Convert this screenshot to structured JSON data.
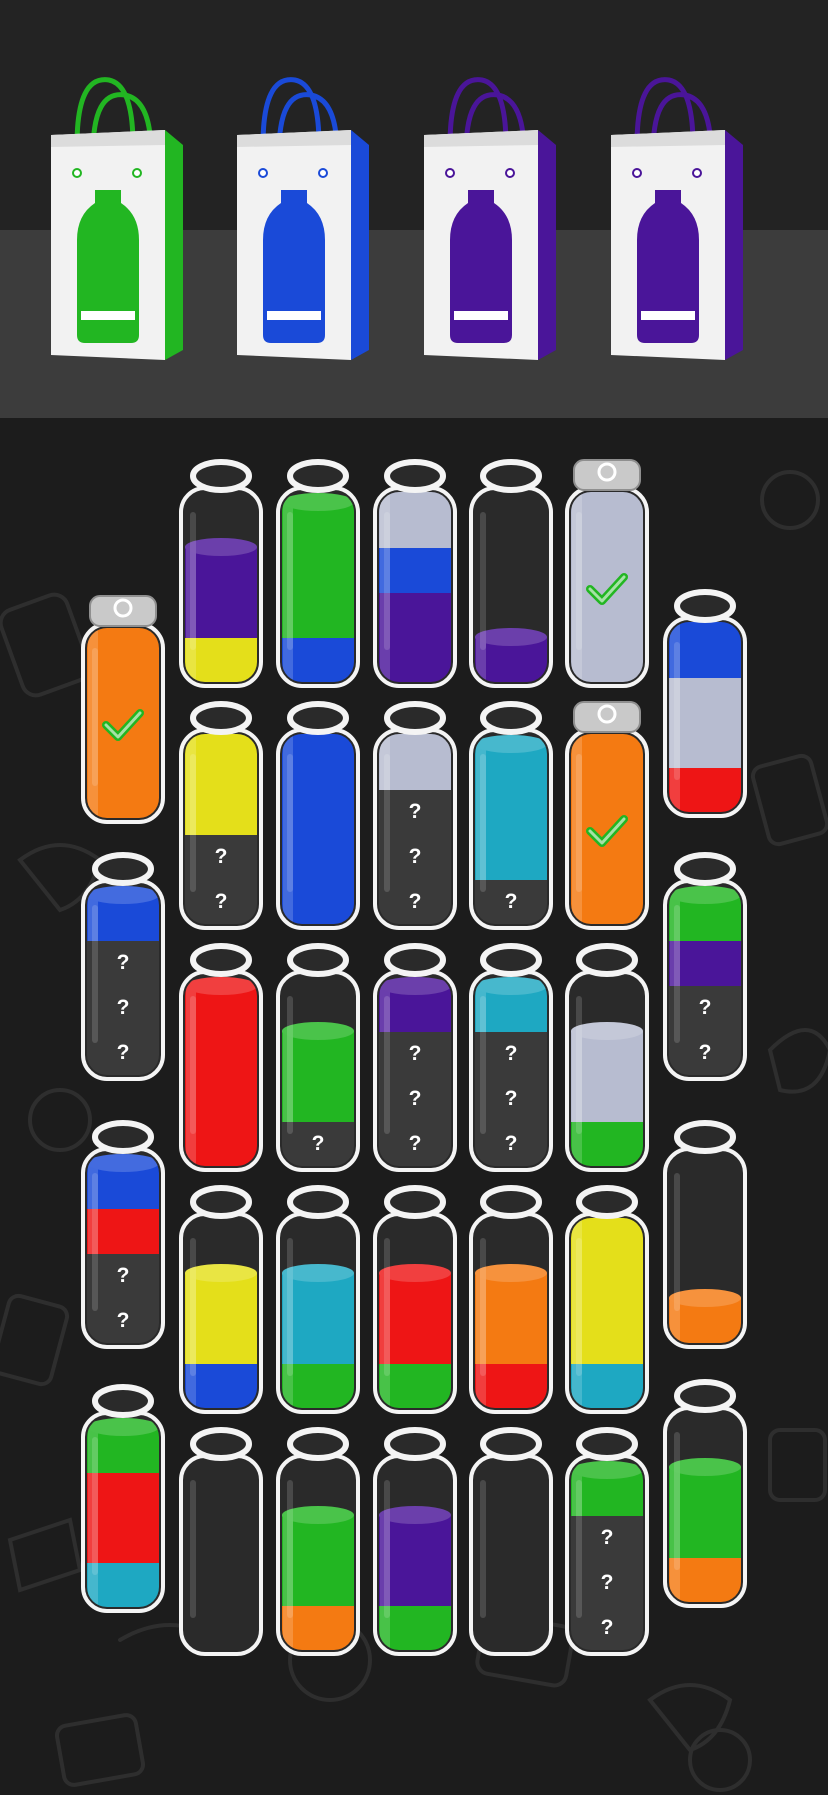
{
  "game": {
    "name": "water-sort-puzzle"
  },
  "colors": {
    "green": "#22b622",
    "blue": "#1a4ad8",
    "purple": "#4a1599",
    "yellow": "#e4df1a",
    "red": "#ee1515",
    "cyan": "#1ea8c2",
    "orange": "#f47a12",
    "silver": "#b7bcd0",
    "background": "#1c1c1c",
    "shelf": "#3c3c3c"
  },
  "bags": [
    {
      "color": "green"
    },
    {
      "color": "blue"
    },
    {
      "color": "purple"
    },
    {
      "color": "purple"
    }
  ],
  "hidden_symbol": "?",
  "bottles": [
    {
      "layers": [
        "purple",
        "purple",
        "yellow"
      ],
      "hidden": 0,
      "capped": false,
      "completed": false
    },
    {
      "layers": [
        "green",
        "green",
        "green",
        "blue"
      ],
      "hidden": 0,
      "capped": false,
      "completed": false
    },
    {
      "layers": [
        "silver",
        "silver",
        "blue",
        "purple",
        "purple"
      ],
      "hidden": 0,
      "capped": false,
      "completed": false
    },
    {
      "layers": [
        "purple"
      ],
      "hidden": 0,
      "capped": false,
      "completed": false
    },
    {
      "layers": [
        "silver",
        "silver",
        "silver",
        "silver",
        "silver"
      ],
      "hidden": 0,
      "capped": true,
      "completed": true
    },
    {
      "layers": [
        "orange",
        "orange",
        "orange",
        "orange",
        "orange"
      ],
      "hidden": 0,
      "capped": true,
      "completed": true
    },
    {
      "layers": [
        "blue",
        "blue",
        "silver",
        "silver",
        "red"
      ],
      "hidden": 0,
      "capped": false,
      "completed": false
    },
    {
      "layers": [
        "yellow",
        "yellow",
        "yellow"
      ],
      "hidden": 2,
      "capped": false,
      "completed": false
    },
    {
      "layers": [
        "blue",
        "blue",
        "blue",
        "blue",
        "blue"
      ],
      "hidden": 0,
      "capped": false,
      "completed": false
    },
    {
      "layers": [
        "silver",
        "silver"
      ],
      "hidden": 3,
      "capped": false,
      "completed": false
    },
    {
      "layers": [
        "cyan",
        "cyan",
        "cyan"
      ],
      "hidden": 1,
      "capped": false,
      "completed": false
    },
    {
      "layers": [
        "orange",
        "orange",
        "orange",
        "orange",
        "orange"
      ],
      "hidden": 0,
      "capped": true,
      "completed": true
    },
    {
      "layers": [
        "blue"
      ],
      "hidden": 3,
      "capped": false,
      "completed": false
    },
    {
      "layers": [
        "green",
        "purple"
      ],
      "hidden": 2,
      "capped": false,
      "completed": false
    },
    {
      "layers": [
        "red",
        "red",
        "red",
        "red"
      ],
      "hidden": 0,
      "capped": false,
      "completed": false
    },
    {
      "layers": [
        "green",
        "green"
      ],
      "hidden": 1,
      "capped": false,
      "completed": false
    },
    {
      "layers": [
        "purple"
      ],
      "hidden": 3,
      "capped": false,
      "completed": false
    },
    {
      "layers": [
        "cyan"
      ],
      "hidden": 3,
      "capped": false,
      "completed": false
    },
    {
      "layers": [
        "silver",
        "silver",
        "green"
      ],
      "hidden": 0,
      "capped": false,
      "completed": false
    },
    {
      "layers": [
        "blue",
        "red"
      ],
      "hidden": 2,
      "capped": false,
      "completed": false
    },
    {
      "layers": [
        "yellow",
        "yellow",
        "blue"
      ],
      "hidden": 0,
      "capped": false,
      "completed": false
    },
    {
      "layers": [
        "cyan",
        "cyan",
        "green"
      ],
      "hidden": 0,
      "capped": false,
      "completed": false
    },
    {
      "layers": [
        "red",
        "red",
        "green"
      ],
      "hidden": 0,
      "capped": false,
      "completed": false
    },
    {
      "layers": [
        "orange",
        "orange",
        "red"
      ],
      "hidden": 0,
      "capped": false,
      "completed": false
    },
    {
      "layers": [
        "yellow",
        "yellow",
        "yellow",
        "yellow",
        "cyan"
      ],
      "hidden": 0,
      "capped": false,
      "completed": false
    },
    {
      "layers": [
        "orange"
      ],
      "hidden": 0,
      "capped": false,
      "completed": false
    },
    {
      "layers": [
        "green",
        "red",
        "red",
        "cyan"
      ],
      "hidden": 0,
      "capped": false,
      "completed": false
    },
    {
      "layers": [],
      "hidden": 0,
      "capped": false,
      "completed": false
    },
    {
      "layers": [
        "green",
        "green",
        "orange"
      ],
      "hidden": 0,
      "capped": false,
      "completed": false
    },
    {
      "layers": [
        "purple",
        "purple",
        "green"
      ],
      "hidden": 0,
      "capped": false,
      "completed": false
    },
    {
      "layers": [],
      "hidden": 0,
      "capped": false,
      "completed": false
    },
    {
      "layers": [
        "green"
      ],
      "hidden": 3,
      "capped": false,
      "completed": false
    },
    {
      "layers": [
        "green",
        "green",
        "orange"
      ],
      "hidden": 0,
      "capped": false,
      "completed": false
    }
  ]
}
